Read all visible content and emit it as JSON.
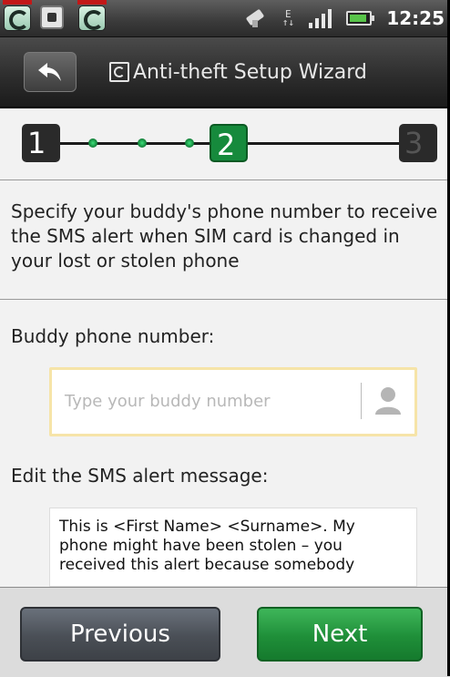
{
  "status_bar": {
    "time": "12:25",
    "icons": [
      "comodo-app-icon",
      "chip-icon",
      "comodo-app-icon",
      "satellite-icon",
      "data-transfer-icon",
      "signal-icon",
      "battery-icon"
    ],
    "edge_label": "E"
  },
  "header": {
    "title": "Anti-theft Setup Wizard",
    "back_icon": "back-arrow-icon",
    "logo_icon": "comodo-logo-icon"
  },
  "wizard": {
    "steps": [
      {
        "label": "1",
        "state": "done"
      },
      {
        "label": "2",
        "state": "current"
      },
      {
        "label": "3",
        "state": "pending"
      }
    ],
    "current_step": 2,
    "total_steps": 3
  },
  "description": "Specify your buddy's phone number to receive the SMS alert when SIM card is changed in your lost or stolen phone",
  "buddy": {
    "label": "Buddy phone number:",
    "placeholder": "Type your buddy number",
    "value": "",
    "contact_icon": "contact-person-icon"
  },
  "sms": {
    "label": "Edit the SMS alert message:",
    "message": "This is <First Name> <Surname>. My phone might have been stolen – you received this alert because somebody"
  },
  "buttons": {
    "previous": "Previous",
    "next": "Next"
  },
  "colors": {
    "accent_green": "#168a3c",
    "next_button": "#1f8f39",
    "previous_button": "#4a4f56",
    "input_border": "#f6e4a8",
    "content_bg": "#f2f2f2"
  }
}
